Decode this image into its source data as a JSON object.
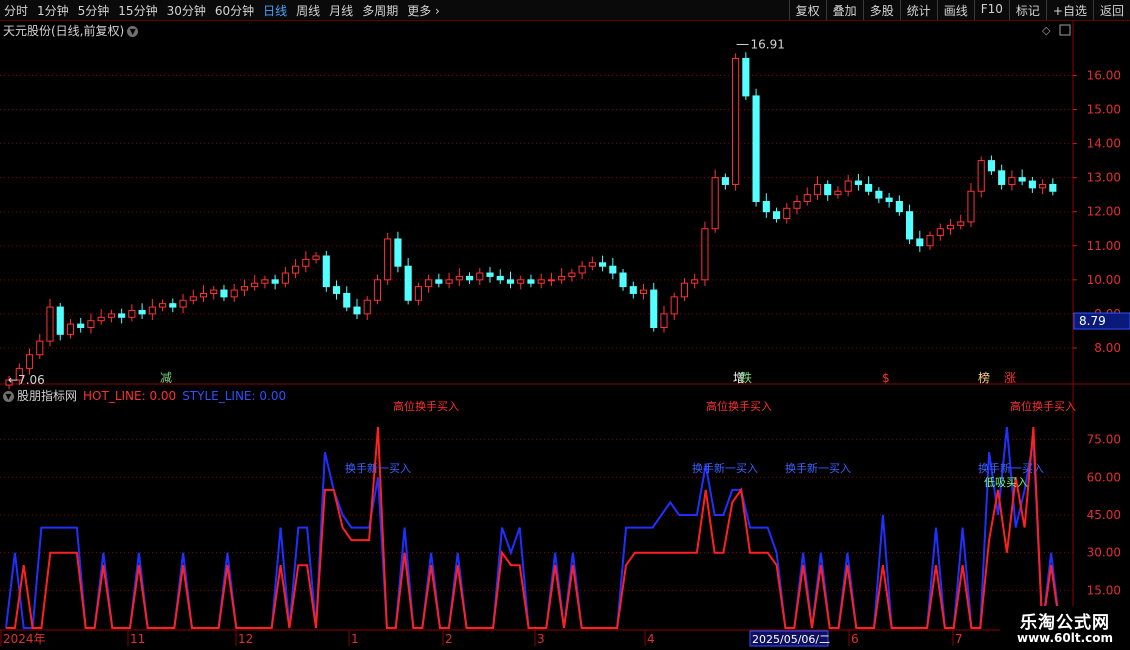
{
  "toolbar": {
    "periods": [
      "分时",
      "1分钟",
      "5分钟",
      "15分钟",
      "30分钟",
      "60分钟",
      "日线",
      "周线",
      "月线",
      "多周期",
      "更多"
    ],
    "active_period": "日线",
    "actions": [
      "复权",
      "叠加",
      "多股",
      "统计",
      "画线",
      "F10",
      "标记",
      "+自选",
      "返回"
    ]
  },
  "stock": {
    "title": "天元股份(日线,前复权)"
  },
  "price_axis": {
    "ticks": [
      "16.00",
      "15.00",
      "14.00",
      "13.00",
      "12.00",
      "11.00",
      "10.00",
      "9.00",
      "8.00"
    ],
    "current": "8.79"
  },
  "annotations": {
    "high": "16.91",
    "low": "7.06"
  },
  "event_markers": [
    {
      "label": "减",
      "color": "#7cd67c"
    },
    {
      "label": "增",
      "color": "#ffffff"
    },
    {
      "label": "跌",
      "color": "#7cd67c"
    },
    {
      "label": "$",
      "color": "#ff3030"
    },
    {
      "label": "榜",
      "color": "#ffd080"
    },
    {
      "label": "涨",
      "color": "#ff3030"
    }
  ],
  "indicator": {
    "name": "股朋指标网",
    "hot_line": "HOT_LINE: 0.00",
    "style_line": "STYLE_LINE: 0.00",
    "axis_ticks": [
      "75.00",
      "60.00",
      "45.00",
      "30.00",
      "15.00"
    ],
    "signal_labels": [
      "高位换手买入",
      "换手新一买入",
      "低吸买入"
    ]
  },
  "date_axis": {
    "labels": [
      "2024年",
      "11",
      "12",
      "1",
      "2",
      "3",
      "4",
      "2025/05/06/二",
      "6",
      "7"
    ]
  },
  "watermark": {
    "name": "乐淘公式网",
    "url": "www.60lt.com"
  },
  "colors": {
    "up": "#ff3232",
    "down": "#54ffff",
    "hot_line": "#ff2020",
    "style_line": "#2030ff",
    "grid": "#8b0000"
  },
  "chart_data": [
    {
      "type": "candlestick",
      "x": "trading days (2024-10 to 2025-07)",
      "ylim": [
        7.0,
        17.1
      ],
      "yticks": [
        8,
        9,
        10,
        11,
        12,
        13,
        14,
        15,
        16
      ],
      "high": 16.91,
      "low": 7.06,
      "last": 8.79,
      "closes": [
        7.06,
        7.4,
        7.8,
        8.2,
        9.2,
        8.4,
        8.7,
        8.6,
        8.8,
        8.9,
        9.0,
        8.9,
        9.1,
        9.0,
        9.2,
        9.3,
        9.2,
        9.4,
        9.5,
        9.6,
        9.7,
        9.5,
        9.7,
        9.8,
        9.9,
        10.0,
        9.9,
        10.2,
        10.4,
        10.6,
        10.7,
        9.8,
        9.6,
        9.2,
        9.0,
        9.4,
        10.0,
        11.2,
        10.4,
        9.4,
        9.8,
        10.0,
        9.9,
        10.0,
        10.1,
        10.0,
        10.2,
        10.1,
        10.0,
        9.9,
        10.0,
        9.9,
        10.0,
        10.0,
        10.1,
        10.2,
        10.4,
        10.5,
        10.4,
        10.2,
        9.8,
        9.6,
        9.7,
        8.6,
        9.0,
        9.5,
        9.9,
        10.0,
        11.5,
        13.0,
        12.8,
        16.5,
        15.4,
        12.3,
        12.0,
        11.8,
        12.1,
        12.3,
        12.5,
        12.8,
        12.5,
        12.6,
        12.9,
        12.8,
        12.6,
        12.4,
        12.3,
        12.0,
        11.2,
        11.0,
        11.3,
        11.5,
        11.6,
        11.7,
        12.6,
        13.5,
        13.2,
        12.8,
        13.0,
        12.9,
        12.7,
        12.8,
        12.6
      ],
      "series": [
        {
          "name": "HOT_LINE",
          "color": "#ff2020"
        },
        {
          "name": "STYLE_LINE",
          "color": "#2030ff"
        }
      ],
      "hot_line": [
        0,
        0,
        25,
        0,
        0,
        30,
        30,
        30,
        30,
        0,
        0,
        25,
        0,
        0,
        0,
        25,
        0,
        0,
        0,
        0,
        25,
        0,
        0,
        0,
        0,
        25,
        0,
        0,
        0,
        0,
        0,
        25,
        0,
        25,
        25,
        0,
        55,
        55,
        40,
        35,
        35,
        35,
        80,
        0,
        0,
        30,
        0,
        0,
        25,
        0,
        0,
        25,
        0,
        0,
        0,
        0,
        30,
        25,
        25,
        0,
        0,
        0,
        25,
        0,
        25,
        0,
        0,
        0,
        0,
        0,
        25,
        30,
        30,
        30,
        30,
        30,
        30,
        30,
        30,
        55,
        30,
        30,
        50,
        55,
        30,
        30,
        30,
        25,
        0,
        0,
        25,
        0,
        25,
        0,
        0,
        25,
        0,
        0,
        0,
        25,
        0,
        0,
        0,
        0,
        0,
        25,
        0,
        0,
        25,
        0,
        0,
        35,
        55,
        30,
        60,
        40,
        80,
        0,
        25,
        0
      ],
      "style_line": [
        0,
        30,
        0,
        0,
        40,
        40,
        40,
        40,
        40,
        0,
        0,
        30,
        0,
        0,
        0,
        30,
        0,
        0,
        0,
        0,
        30,
        0,
        0,
        0,
        0,
        30,
        0,
        0,
        0,
        0,
        0,
        40,
        0,
        40,
        40,
        0,
        70,
        55,
        45,
        40,
        40,
        40,
        60,
        0,
        0,
        40,
        0,
        0,
        30,
        0,
        0,
        30,
        0,
        0,
        0,
        0,
        40,
        30,
        40,
        0,
        0,
        0,
        30,
        0,
        30,
        0,
        0,
        0,
        0,
        0,
        40,
        40,
        40,
        40,
        45,
        50,
        45,
        45,
        45,
        65,
        45,
        45,
        55,
        55,
        40,
        40,
        40,
        30,
        0,
        0,
        30,
        0,
        30,
        0,
        0,
        30,
        0,
        0,
        0,
        45,
        0,
        0,
        0,
        0,
        0,
        40,
        0,
        0,
        40,
        0,
        0,
        70,
        45,
        80,
        40,
        55,
        75,
        0,
        30,
        0
      ],
      "indicator_ylim": [
        0,
        90
      ],
      "indicator_yticks": [
        15,
        30,
        45,
        60,
        75
      ]
    }
  ]
}
